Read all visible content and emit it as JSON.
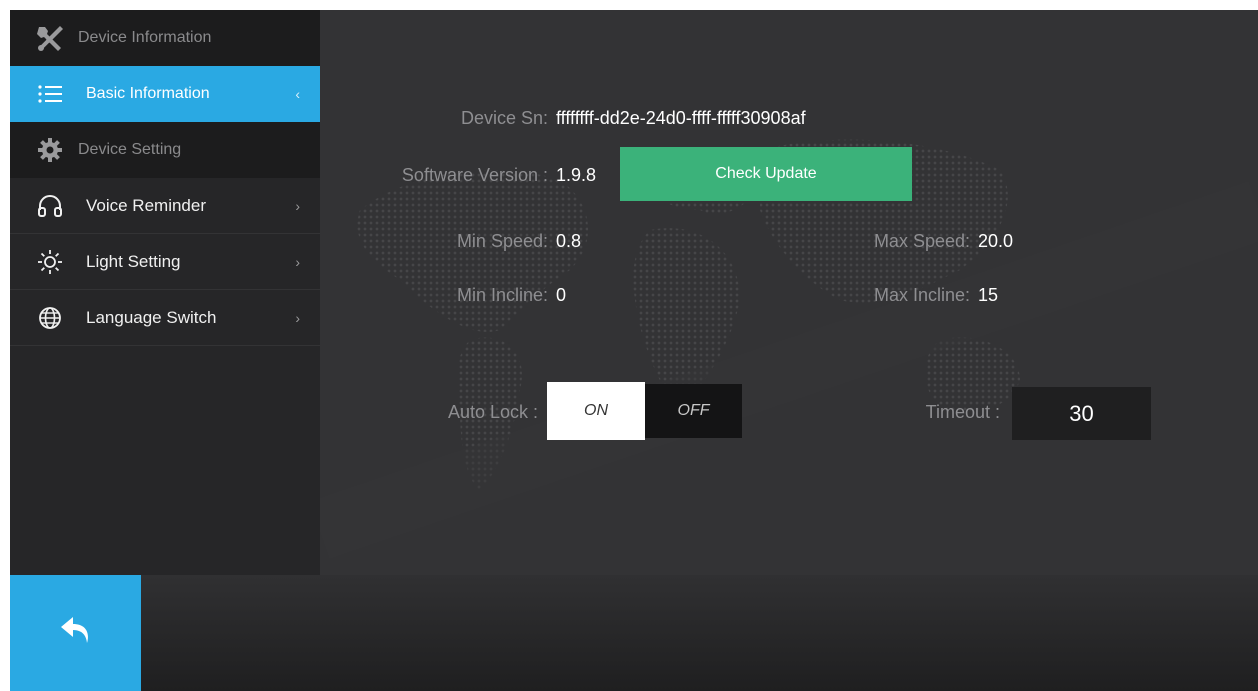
{
  "sidebar": {
    "device_information_header": "Device Information",
    "device_setting_header": "Device Setting",
    "items": [
      {
        "label": "Basic Information",
        "icon": "list-icon",
        "active": true
      },
      {
        "label": "Voice Reminder",
        "icon": "headphones-icon"
      },
      {
        "label": "Light Setting",
        "icon": "sun-icon"
      },
      {
        "label": "Language Switch",
        "icon": "globe-icon"
      }
    ],
    "header_icons": [
      "tools-icon",
      "gear-icon"
    ]
  },
  "info": {
    "device_sn_label": "Device Sn:",
    "device_sn_value": "ffffffff-dd2e-24d0-ffff-fffff30908af",
    "software_version_label": "Software Version :",
    "software_version_value": "1.9.8",
    "check_update_label": "Check Update",
    "min_speed_label": "Min Speed:",
    "min_speed_value": "0.8",
    "max_speed_label": "Max Speed:",
    "max_speed_value": "20.0",
    "min_incline_label": "Min Incline:",
    "min_incline_value": "0",
    "max_incline_label": "Max Incline:",
    "max_incline_value": "15"
  },
  "auto_lock": {
    "label": "Auto Lock :",
    "on_label": "ON",
    "off_label": "OFF",
    "selected": "ON"
  },
  "timeout": {
    "label": "Timeout :",
    "value": "30"
  },
  "footer": {
    "back_icon": "back-arrow-icon"
  },
  "colors": {
    "accent": "#2aa9e3",
    "check_update": "#3bb27a"
  }
}
